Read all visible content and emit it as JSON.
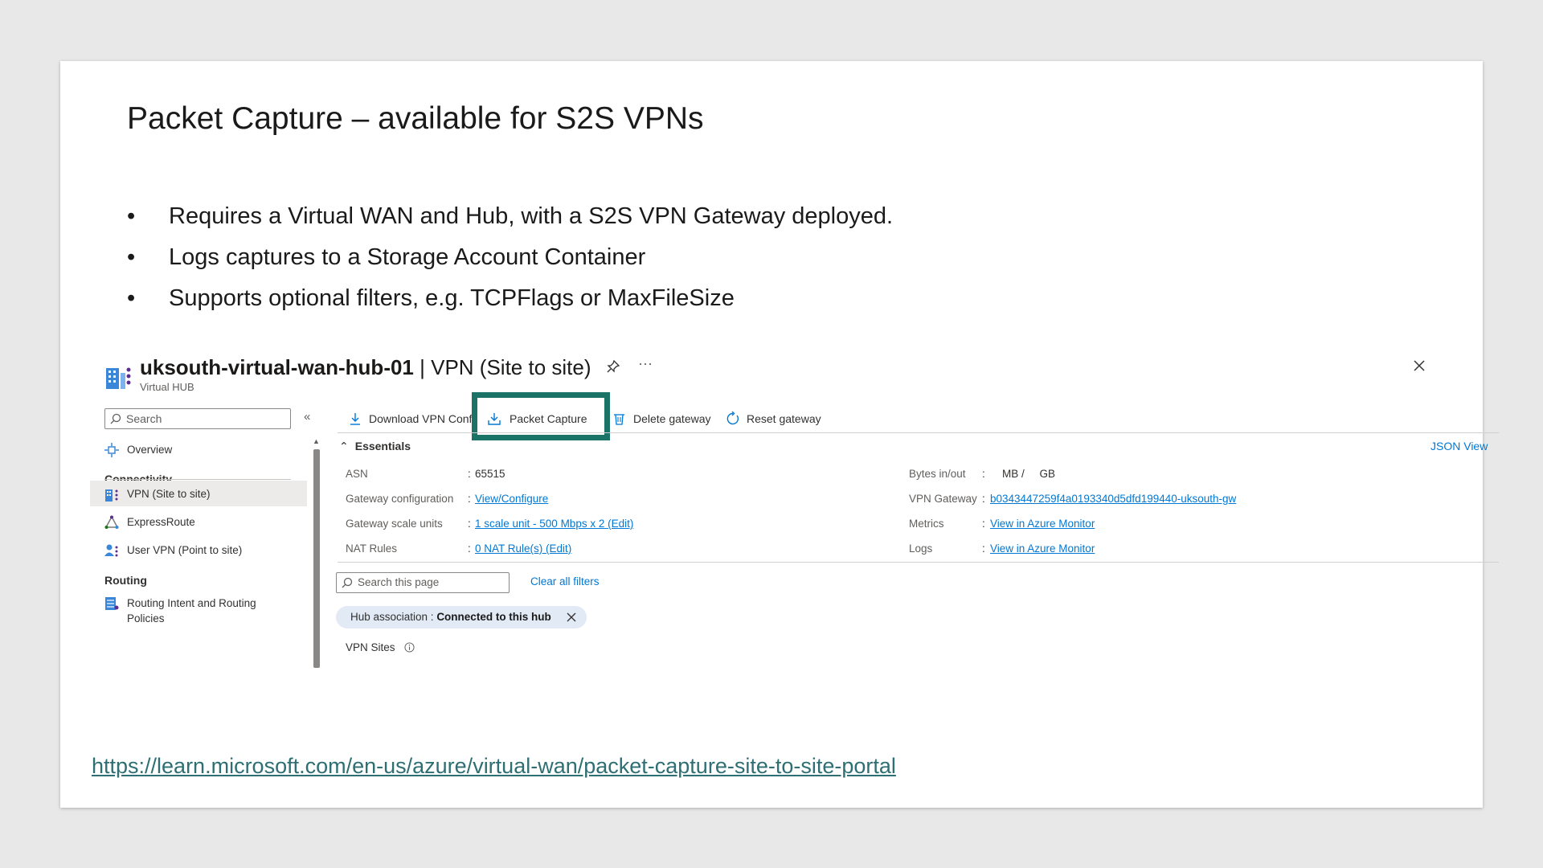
{
  "slide": {
    "title": "Packet Capture – available for S2S VPNs",
    "bullet_marker": "•",
    "bullets": [
      "Requires a Virtual WAN and Hub, with a S2S VPN Gateway deployed.",
      "Logs captures to a Storage Account Container",
      "Supports optional filters, e.g. TCPFlags or MaxFileSize"
    ],
    "link": "https://learn.microsoft.com/en-us/azure/virtual-wan/packet-capture-site-to-site-portal"
  },
  "azure": {
    "title_bold": "uksouth-virtual-wan-hub-01",
    "title_rest": " | VPN (Site to site)",
    "subtitle": "Virtual HUB",
    "more": "···",
    "search_placeholder": "Search",
    "collapse": "«",
    "nav": {
      "overview": "Overview",
      "connectivity": "Connectivity",
      "vpn_site": "VPN (Site to site)",
      "expressroute": "ExpressRoute",
      "user_vpn": "User VPN (Point to site)",
      "routing": "Routing",
      "routing_intent_1": "Routing Intent and Routing",
      "routing_intent_2": "Policies"
    },
    "toolbar": {
      "download": "Download VPN Config",
      "packet_capture": "Packet Capture",
      "delete": "Delete gateway",
      "reset": "Reset gateway"
    },
    "essentials": "Essentials",
    "json_view": "JSON View",
    "left_props": [
      {
        "label": "ASN",
        "value": "65515",
        "link": false
      },
      {
        "label": "Gateway configuration",
        "value": "View/Configure",
        "link": true
      },
      {
        "label": "Gateway scale units",
        "value": "1 scale unit - 500 Mbps x 2 (Edit)",
        "link": true
      },
      {
        "label": "NAT Rules",
        "value": "0 NAT Rule(s) (Edit)",
        "link": true
      }
    ],
    "right_props": [
      {
        "label": "Bytes in/out",
        "value": "MB /     GB",
        "link": false
      },
      {
        "label": "VPN Gateway",
        "value": "b0343447259f4a0193340d5dfd199440-uksouth-gw",
        "link": true
      },
      {
        "label": "Metrics",
        "value": "View in Azure Monitor",
        "link": true
      },
      {
        "label": "Logs",
        "value": "View in Azure Monitor",
        "link": true
      }
    ],
    "colon": ":",
    "page_search_placeholder": "Search this page",
    "clear_filters": "Clear all filters",
    "pill_label": "Hub association : ",
    "pill_value": "Connected to this hub",
    "vpn_sites": "VPN Sites",
    "accent": "#0078d4",
    "highlight": "#1a7366"
  }
}
